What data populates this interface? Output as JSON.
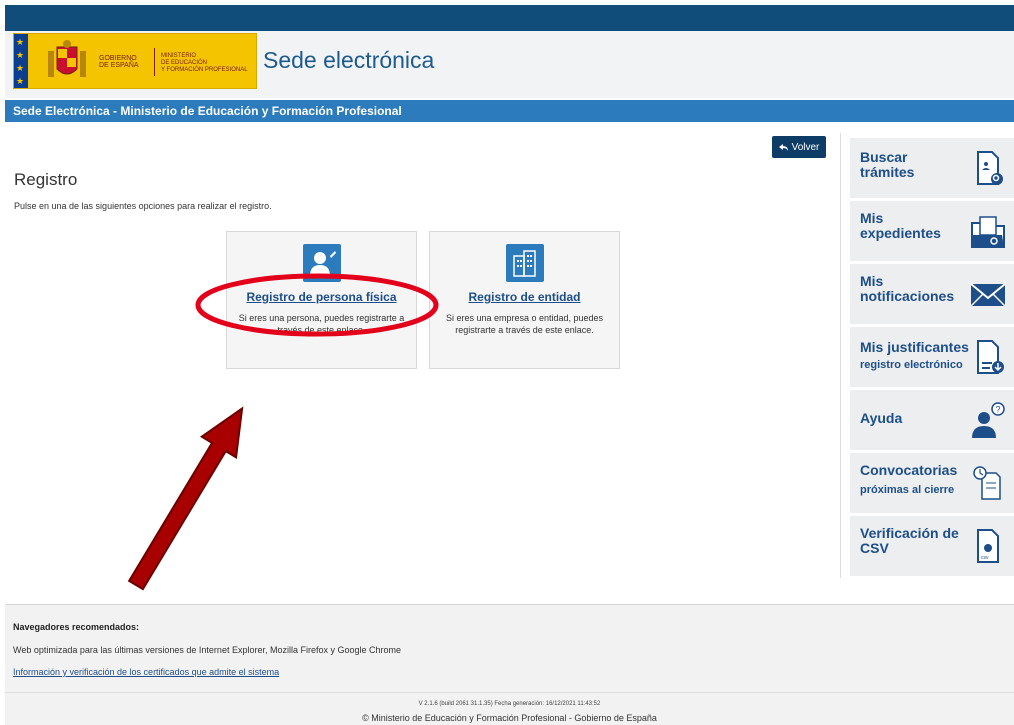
{
  "header": {
    "site_title": "Sede electrónica",
    "logo_government": "GOBIERNO\nDE ESPAÑA",
    "logo_ministry": "MINISTERIO\nDE EDUCACIÓN\nY FORMACIÓN PROFESIONAL"
  },
  "breadcrumb_bar": "Sede Electrónica - Ministerio de Educación y Formación Profesional",
  "back_button": "Volver",
  "main": {
    "title": "Registro",
    "instructions": "Pulse en una de las siguientes opciones para realizar el registro.",
    "options": [
      {
        "title": "Registro de persona física",
        "description": "Si eres una persona, puedes registrarte a través de este enlace."
      },
      {
        "title": "Registro de entidad",
        "description": "Si eres una empresa o entidad, puedes registrarte a través de este enlace."
      }
    ]
  },
  "sidebar": {
    "items": [
      {
        "label": "Buscar trámites",
        "sub": "",
        "icon": "document-search-icon"
      },
      {
        "label": "Mis expedientes",
        "sub": "",
        "icon": "folder-search-icon"
      },
      {
        "label": "Mis notificaciones",
        "sub": "",
        "icon": "envelope-icon"
      },
      {
        "label": "Mis justificantes",
        "sub": "registro electrónico",
        "icon": "document-download-icon"
      },
      {
        "label": "Ayuda",
        "sub": "",
        "icon": "help-person-icon"
      },
      {
        "label": "Convocatorias",
        "sub": "próximas al cierre",
        "icon": "clock-document-icon"
      },
      {
        "label": "Verificación de CSV",
        "sub": "",
        "icon": "csv-verify-icon"
      }
    ]
  },
  "footer": {
    "recommended_title": "Navegadores recomendados:",
    "recommended_text": "Web optimizada para las últimas versiones de Internet Explorer, Mozilla Firefox y Google Chrome",
    "certificates_link": "Información y verificación de los certificados que admite el sistema",
    "version": "V 2.1.6 (build 2061 31.1.35) Fecha generación: 16/12/2021 11:43:52",
    "copyright": "© Ministerio de Educación y Formación Profesional - Gobierno de España"
  },
  "colors": {
    "top_bar": "#104d7a",
    "blue_bar": "#2b7bbd",
    "link": "#1d4e89",
    "annotation": "#e3001b",
    "arrow": "#a80000"
  }
}
